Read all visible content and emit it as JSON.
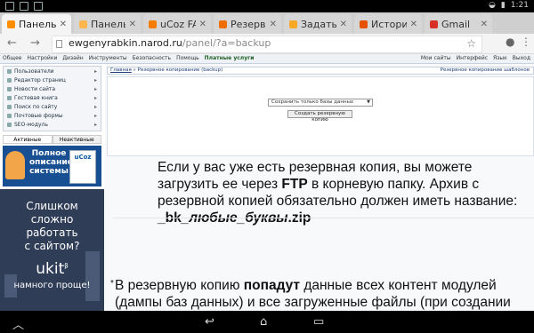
{
  "status_bar": {
    "time": "1:21"
  },
  "tabs": [
    {
      "label": "Панель у",
      "color": "#ff8f00",
      "active": true
    },
    {
      "label": "Панель у",
      "color": "#ffb74d",
      "active": false
    },
    {
      "label": "uCoz FAQ",
      "color": "#f57c00",
      "active": false
    },
    {
      "label": "Резервно",
      "color": "#ef6c00",
      "active": false
    },
    {
      "label": "Задать в",
      "color": "#f9a825",
      "active": false
    },
    {
      "label": "История",
      "color": "#e65100",
      "active": false
    },
    {
      "label": "Gmail",
      "color": "#d93025",
      "active": false
    }
  ],
  "address_bar": {
    "host": "ewgenyrabkin.narod.ru",
    "path": "/panel/?a=backup"
  },
  "ucoz_menu": {
    "items": [
      "Общее",
      "Настройки",
      "Дизайн",
      "Инструменты",
      "Безопасность",
      "Помощь"
    ],
    "paid": "Платные услуги",
    "right": [
      "Мои сайты",
      "Интерфейс",
      "Язык",
      "Выход"
    ]
  },
  "sidebar": {
    "items": [
      "Пользователи",
      "Редактор страниц",
      "Новости сайта",
      "Гостевая книга",
      "Поиск по сайту",
      "Почтовые формы",
      "SEO-модуль"
    ],
    "tabs": [
      "Активные",
      "Неактивные"
    ],
    "promo1": {
      "text": "Полное описание системы",
      "brand": "uCoz"
    },
    "promo2": {
      "lines": [
        "Слишком",
        "сложно",
        "работать",
        "с сайтом?"
      ],
      "brand": "ukit",
      "brand_sup": "β",
      "tagline": "намного проще!"
    }
  },
  "panel": {
    "crumb_home": "Главная",
    "crumb_sep": " » ",
    "crumb_current": "Резервное копирование (backup)",
    "right_link": "Резервное копирование шаблонов",
    "select_value": "Сохранить только базы данных",
    "create_button": "Создать резервную копию"
  },
  "note1": {
    "text_a": "Если у вас уже есть резервная копия, вы можете загрузить ее через ",
    "ftp": "FTP",
    "text_b": " в корневую папку. Архив с резервной копией обязательно должен иметь название: ",
    "bk": "_bk",
    "bk_italic": "_любые_буквы",
    "bk_ext": ".zip"
  },
  "note2": {
    "bullet": "*",
    "text_a": " В резервную копию ",
    "bold": "попадут",
    "text_b": " данные всех контент модулей (дампы баз данных) и все загруженные файлы (при создании полной копии)"
  }
}
